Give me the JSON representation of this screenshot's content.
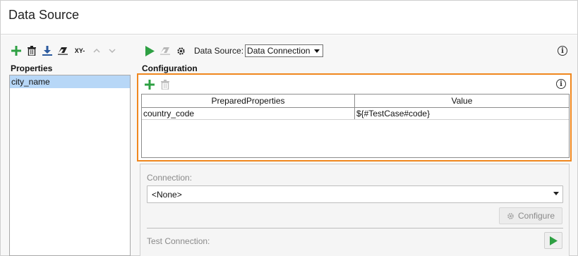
{
  "window": {
    "title": "Data Source"
  },
  "left_toolbar": {
    "items": [
      {
        "icon": "plus-icon",
        "color": "#2ea043"
      },
      {
        "icon": "trash-icon"
      },
      {
        "icon": "download-icon",
        "color": "#2b5a9e"
      },
      {
        "icon": "eraser-icon"
      },
      {
        "icon": "xy-icon",
        "label": "XY-"
      },
      {
        "icon": "chevron-up-icon"
      },
      {
        "icon": "chevron-down-icon"
      }
    ]
  },
  "properties": {
    "heading": "Properties",
    "items": [
      "city_name"
    ],
    "selected_index": 0
  },
  "main_toolbar": {
    "run_icon": "play-icon",
    "clear_icon": "eraser-icon",
    "settings_icon": "gear-icon",
    "data_source_label": "Data Source:",
    "data_source_value": "Data Connection",
    "info_icon": "info-icon"
  },
  "configuration": {
    "heading": "Configuration",
    "table": {
      "columns": [
        "PreparedProperties",
        "Value"
      ],
      "rows": [
        [
          "country_code",
          "${#TestCase#code}"
        ]
      ]
    }
  },
  "connection": {
    "label": "Connection:",
    "value": "<None>",
    "configure_label": "Configure",
    "test_label": "Test Connection:"
  },
  "colors": {
    "accent_highlight": "#f0871e",
    "selection": "#b7d7f7",
    "run_green": "#2ea043"
  }
}
